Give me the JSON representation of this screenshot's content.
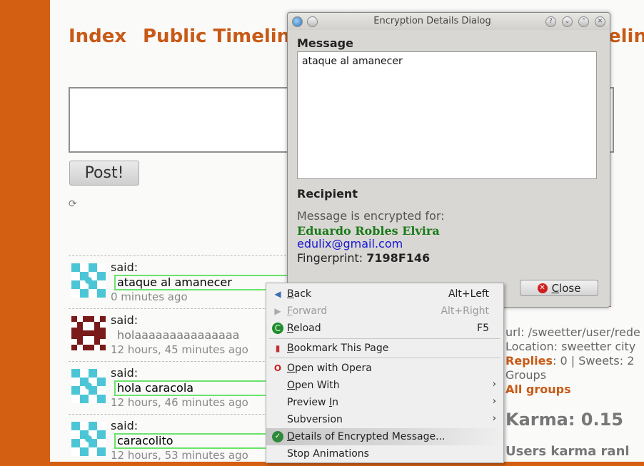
{
  "nav": {
    "index": "Index",
    "public_timeline": "Public Timelin",
    "right_fragment": "eline"
  },
  "composer": {
    "post_label": "Post!"
  },
  "feed": [
    {
      "said": "said:",
      "message": "ataque al amanecer",
      "time": "0 minutes ago",
      "avatar_color": "#4cc6d6",
      "highlight": true
    },
    {
      "said": "said:",
      "message": "holaaaaaaaaaaaaaaa",
      "time": "12 hours, 45 minutes ago",
      "avatar_color": "#7a1a1a",
      "highlight": false
    },
    {
      "said": "said:",
      "message": "hola caracola",
      "time": "12 hours, 46 minutes ago",
      "avatar_color": "#4cc6d6",
      "highlight": true
    },
    {
      "said": "said:",
      "message": "caracolito",
      "time": "12 hours, 53 minutes ago",
      "avatar_color": "#4cc6d6",
      "highlight": true
    }
  ],
  "sidebar": {
    "url": "url: /sweetter/user/rede",
    "location": "Location: sweetter city",
    "replies_label": "Replies",
    "replies_rest": ": 0 | Sweets: 2",
    "groups": "Groups",
    "all_groups": "All groups",
    "karma": "Karma: 0.15",
    "users_karma": "Users karma ranl",
    "k_fragment": "k"
  },
  "dialog": {
    "title": "Encryption Details Dialog",
    "message_heading": "Message",
    "message_text": "ataque al amanecer",
    "recipient_heading": "Recipient",
    "encrypted_for": "Message is encrypted for:",
    "recipient_name": "Eduardo Robles Elvira",
    "recipient_email": "edulix@gmail.com",
    "fingerprint_label": "Fingerprint: ",
    "fingerprint_value": "7198F146",
    "close_prefix": "",
    "close_underlined": "C",
    "close_rest": "lose"
  },
  "context_menu": {
    "back": {
      "u": "B",
      "rest": "ack",
      "shortcut": "Alt+Left"
    },
    "forward": {
      "u": "F",
      "rest": "orward",
      "shortcut": "Alt+Right"
    },
    "reload": {
      "u": "R",
      "rest": "eload",
      "shortcut": "F5"
    },
    "bookmark": {
      "u": "B",
      "rest": "ookmark This Page"
    },
    "open_opera": {
      "u": "O",
      "rest": "pen with Opera"
    },
    "open_with": {
      "u": "O",
      "rest": "pen With"
    },
    "preview_in": {
      "pre": "Preview ",
      "u": "I",
      "rest": "n"
    },
    "subversion": {
      "label": "Subversion"
    },
    "details_encrypted": {
      "u": "D",
      "rest": "etails of Encrypted Message..."
    },
    "stop_animations": {
      "label": "Stop Animations"
    }
  },
  "colors": {
    "accent_orange": "#c85a16",
    "sidebar_orange": "#d35f12",
    "recipient_green": "#1a7a1a",
    "email_blue": "#1515d4",
    "highlight_green": "#6be36b"
  },
  "icons": [
    "refresh-icon",
    "back-arrow-icon",
    "forward-arrow-icon",
    "reload-icon",
    "bookmark-icon",
    "opera-icon",
    "shield-check-icon",
    "close-icon",
    "kde-app-icon",
    "help-icon",
    "minimize-icon",
    "maximize-icon",
    "window-close-icon",
    "submenu-arrow-icon"
  ]
}
